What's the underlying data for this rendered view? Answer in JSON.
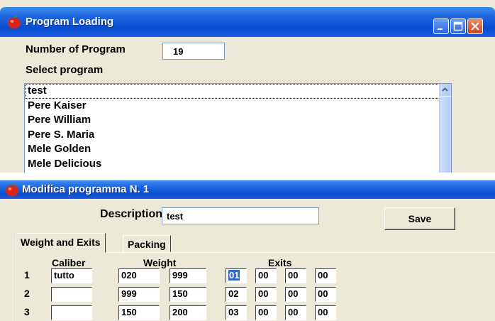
{
  "loading_window": {
    "title": "Program Loading",
    "number_label": "Number of Program",
    "number_value": "19",
    "select_label": "Select program",
    "programs": [
      "test",
      "Pere Kaiser",
      "Pere William",
      "Pere S. Maria",
      "Mele Golden",
      "Mele Delicious"
    ]
  },
  "edit_window": {
    "title": "Modifica programma N. 1",
    "description_label": "Description",
    "description_value": "test",
    "save_label": "Save",
    "tabs": [
      "Weight and Exits",
      "Packing"
    ],
    "headers": {
      "caliber": "Caliber",
      "weight": "Weight",
      "exits": "Exits"
    },
    "rows": [
      {
        "num": "1",
        "caliber": "tutto",
        "w1": "020",
        "w2": "999",
        "exits": [
          "01",
          "00",
          "00",
          "00"
        ]
      },
      {
        "num": "2",
        "caliber": "",
        "w1": "999",
        "w2": "150",
        "exits": [
          "02",
          "00",
          "00",
          "00"
        ]
      },
      {
        "num": "3",
        "caliber": "",
        "w1": "150",
        "w2": "200",
        "exits": [
          "03",
          "00",
          "00",
          "00"
        ]
      }
    ]
  },
  "colors": {
    "titlebar": "#0a4ed0",
    "face": "#ece9d8",
    "selection": "#316ac5"
  }
}
